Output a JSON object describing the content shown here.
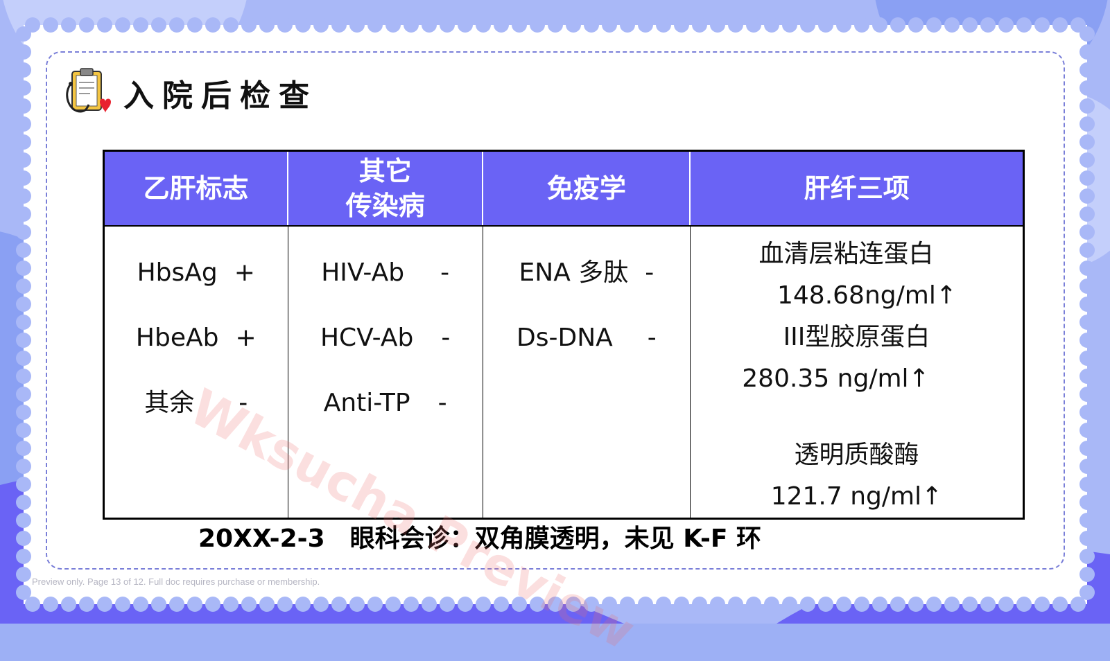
{
  "heading": "入院后检查",
  "table": {
    "headers": [
      "乙肝标志",
      "其它\n传染病",
      "免疫学",
      "肝纤三项"
    ],
    "hbv": [
      {
        "name": "HbsAg",
        "sign": "+"
      },
      {
        "name": "HbeAb",
        "sign": "+"
      },
      {
        "name": "其余",
        "sign": "-"
      }
    ],
    "infectious": [
      {
        "name": "HIV-Ab",
        "sign": "-"
      },
      {
        "name": "HCV-Ab",
        "sign": "-"
      },
      {
        "name": "Anti-TP",
        "sign": "-"
      }
    ],
    "immunology": [
      {
        "name": "ENA 多肽",
        "sign": "-"
      },
      {
        "name": "Ds-DNA",
        "sign": "-"
      }
    ],
    "fibrosis": [
      "血清层粘连蛋白",
      "148.68ng/ml↑",
      "III型胶原蛋白",
      "280.35 ng/ml↑",
      "",
      "透明质酸酶",
      "121.7 ng/ml↑"
    ]
  },
  "note": "20XX-2-3　眼科会诊：双角膜透明，未见 K-F 环",
  "watermark": "Wksucha Preview",
  "preview_notice": "Preview only. Page 13 of 12. Full doc requires purchase or membership.",
  "colors": {
    "header_bg": "#6a63f5",
    "frame_blue": "#6a63f5",
    "background_blue": "#9db0f5"
  },
  "icons": [
    "clipboard-stethoscope-icon",
    "heart-icon"
  ]
}
